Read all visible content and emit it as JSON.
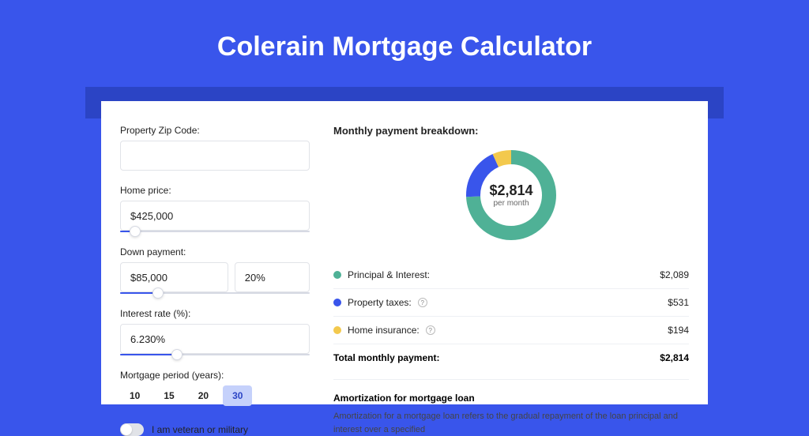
{
  "title": "Colerain Mortgage Calculator",
  "form": {
    "zip_label": "Property Zip Code:",
    "zip_value": "",
    "home_price_label": "Home price:",
    "home_price_value": "$425,000",
    "home_price_slider_percent": 8,
    "down_payment_label": "Down payment:",
    "down_payment_value": "$85,000",
    "down_payment_pct_value": "20%",
    "down_payment_slider_percent": 20,
    "interest_label": "Interest rate (%):",
    "interest_value": "6.230%",
    "interest_slider_percent": 30,
    "period_label": "Mortgage period (years):",
    "period_options": [
      "10",
      "15",
      "20",
      "30"
    ],
    "period_active_index": 3,
    "veteran_label": "I am veteran or military"
  },
  "breakdown": {
    "title": "Monthly payment breakdown:",
    "center_amount": "$2,814",
    "center_period": "per month",
    "items": [
      {
        "label": "Principal & Interest:",
        "amount": "$2,089",
        "color": "#4fb196",
        "info": false
      },
      {
        "label": "Property taxes:",
        "amount": "$531",
        "color": "#3955eb",
        "info": true
      },
      {
        "label": "Home insurance:",
        "amount": "$194",
        "color": "#f3c94d",
        "info": true
      }
    ],
    "total_label": "Total monthly payment:",
    "total_amount": "$2,814"
  },
  "chart_data": {
    "type": "pie",
    "title": "Monthly payment breakdown",
    "series": [
      {
        "name": "Principal & Interest",
        "value": 2089,
        "color": "#4fb196"
      },
      {
        "name": "Property taxes",
        "value": 531,
        "color": "#3955eb"
      },
      {
        "name": "Home insurance",
        "value": 194,
        "color": "#f3c94d"
      }
    ],
    "total": 2814
  },
  "amortization": {
    "title": "Amortization for mortgage loan",
    "text": "Amortization for a mortgage loan refers to the gradual repayment of the loan principal and interest over a specified"
  }
}
